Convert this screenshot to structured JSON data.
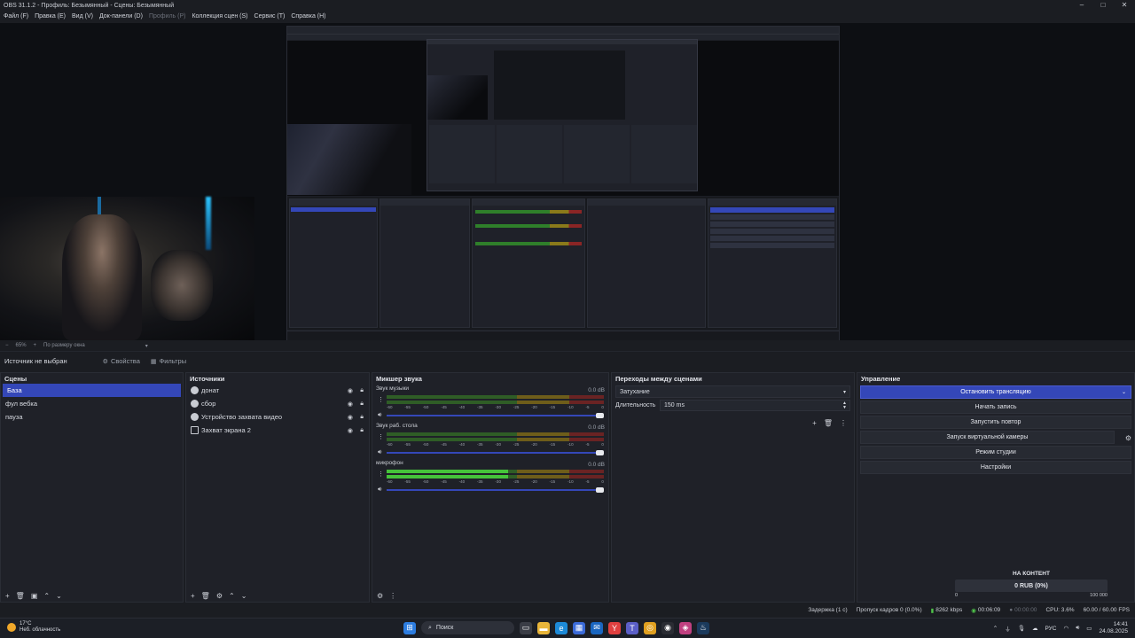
{
  "window": {
    "title": "OBS 31.1.2 - Профиль: Безымянный - Сцены: Безымянный",
    "minimize": "–",
    "maximize": "□",
    "close": "✕"
  },
  "menu": [
    {
      "label": "Файл (F)",
      "enabled": true
    },
    {
      "label": "Правка (E)",
      "enabled": true
    },
    {
      "label": "Вид (V)",
      "enabled": true
    },
    {
      "label": "Док-панели (D)",
      "enabled": true
    },
    {
      "label": "Профиль (P)",
      "enabled": false
    },
    {
      "label": "Коллекция сцен (S)",
      "enabled": true
    },
    {
      "label": "Сервис (T)",
      "enabled": true
    },
    {
      "label": "Справка (H)",
      "enabled": true
    }
  ],
  "preview_footer": {
    "zoom": "65%",
    "scale_mode": "По размеру окна"
  },
  "source_toolbar": {
    "status": "Источник не выбран",
    "properties": "Свойства",
    "filters": "Фильтры"
  },
  "scenes": {
    "title": "Сцены",
    "items": [
      {
        "label": "База",
        "selected": true
      },
      {
        "label": "фул вебка",
        "selected": false
      },
      {
        "label": "пауза",
        "selected": false
      }
    ]
  },
  "sources": {
    "title": "Источники",
    "items": [
      {
        "label": "донат",
        "icon": "globe-icon"
      },
      {
        "label": "сбор",
        "icon": "globe-icon"
      },
      {
        "label": "Устройство захвата видео",
        "icon": "globe-icon"
      },
      {
        "label": "Захват экрана 2",
        "icon": "monitor-icon"
      }
    ]
  },
  "mixer": {
    "title": "Микшер звука",
    "ticks": [
      "-60",
      "-55",
      "-50",
      "-45",
      "-40",
      "-35",
      "-30",
      "-25",
      "-20",
      "-15",
      "-10",
      "-5",
      "0"
    ],
    "channels": [
      {
        "name": "Звук музыки",
        "db": "0.0 dB",
        "active": false
      },
      {
        "name": "Звук раб. стола",
        "db": "0.0 dB",
        "active": false
      },
      {
        "name": "микрофон",
        "db": "0.0 dB",
        "active": true
      }
    ]
  },
  "transitions": {
    "title": "Переходы между сценами",
    "selected": "Затухание",
    "duration_label": "Длительность",
    "duration_value": "150 ms"
  },
  "controls": {
    "title": "Управление",
    "stop_stream": "Остановить трансляцию",
    "start_record": "Начать запись",
    "start_replay": "Запустить повтор",
    "virtual_cam": "Запуск виртуальной камеры",
    "studio_mode": "Режим студии",
    "settings": "Настройки"
  },
  "donation": {
    "title": "НА КОНТЕНТ",
    "value": "0 RUB (0%)",
    "min": "0",
    "max": "100 000"
  },
  "status": {
    "delay": "Задержка (1 с)",
    "dropped": "Пропуск кадров 0 (0.0%)",
    "bitrate": "8262 kbps",
    "stream_time": "00:06:09",
    "rec_time": "00:00:00",
    "cpu": "CPU: 3.6%",
    "fps": "60.00 / 60.00 FPS"
  },
  "taskbar": {
    "weather_temp": "17°C",
    "weather_desc": "Неб. облачность",
    "search": "Поиск",
    "lang": "РУС",
    "time": "14:41",
    "date": "24.08.2025"
  },
  "colors": {
    "accent": "#3447b8",
    "bg": "#1f2128",
    "meter_green": "#45c33a"
  }
}
